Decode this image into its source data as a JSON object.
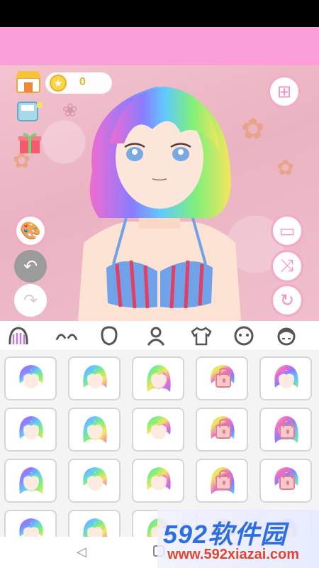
{
  "topbar": {
    "coins": "0"
  },
  "hair_colors": [
    "#f06bd0",
    "#8a7cff",
    "#61c9ff",
    "#7ff07a",
    "#f5e65a"
  ],
  "accent": "#f48fc0",
  "tabs": [
    "hair",
    "eyebrows",
    "face",
    "body",
    "clothes",
    "expression",
    "hat"
  ],
  "grid": {
    "rows": [
      [
        {
          "locked": false
        },
        {
          "locked": false
        },
        {
          "locked": false
        },
        {
          "locked": true
        },
        {
          "locked": false
        }
      ],
      [
        {
          "locked": false
        },
        {
          "locked": false
        },
        {
          "locked": false
        },
        {
          "locked": true
        },
        {
          "locked": true
        }
      ],
      [
        {
          "locked": false
        },
        {
          "locked": false
        },
        {
          "locked": false
        },
        {
          "locked": true
        },
        {
          "locked": true
        }
      ],
      [
        {
          "locked": false
        },
        {
          "locked": false
        },
        {
          "locked": false
        },
        {
          "locked": true
        },
        {
          "locked": true
        }
      ]
    ]
  },
  "watermark": {
    "brand": "592软件园",
    "url": "www.592xiazai.com"
  }
}
